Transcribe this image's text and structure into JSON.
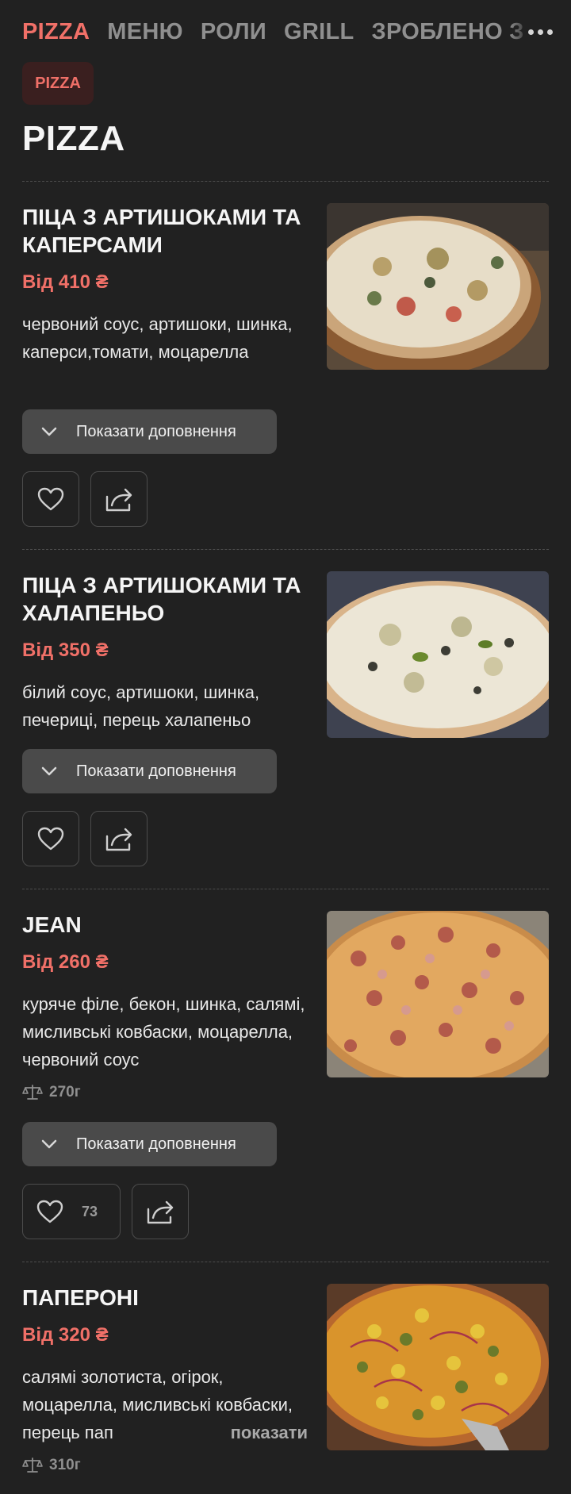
{
  "nav": {
    "items": [
      {
        "label": "PIZZA",
        "active": true
      },
      {
        "label": "МЕНЮ",
        "active": false
      },
      {
        "label": "РОЛИ",
        "active": false
      },
      {
        "label": "GRILL",
        "active": false
      },
      {
        "label": "ЗРОБЛЕНО З",
        "active": false
      }
    ],
    "more_icon": "more-horizontal-icon"
  },
  "category_chip": "PIZZA",
  "section_title": "PIZZA",
  "addons_label": "Показати доповнення",
  "products": [
    {
      "name": "ПІЦА З АРТИШОКАМИ ТА КАПЕРСАМИ",
      "price": "Від 410 ₴",
      "description": "червоний соус, артишоки, шинка, каперси,томати, моцарелла"
    },
    {
      "name": "ПІЦА З АРТИШОКАМИ ТА ХАЛАПЕНЬО",
      "price": "Від 350 ₴",
      "description": "білий соус, артишоки, шинка, печериці, перець халапеньо"
    },
    {
      "name": "JEAN",
      "price": "Від 260 ₴",
      "description": "куряче філе, бекон, шинка, салямі, мисливські ковбаски, моцарелла, червоний соус",
      "weight": "270г",
      "likes": "73"
    },
    {
      "name": "ПАПЕРОНІ",
      "price": "Від 320 ₴",
      "description": "салямі золотиста, огірок, моцарелла, мисливські ковбаски, перець пап",
      "more_label": "показати",
      "weight": "310г"
    }
  ],
  "colors": {
    "background": "#212121",
    "accent": "#f07068",
    "button": "#4a4a4a"
  }
}
